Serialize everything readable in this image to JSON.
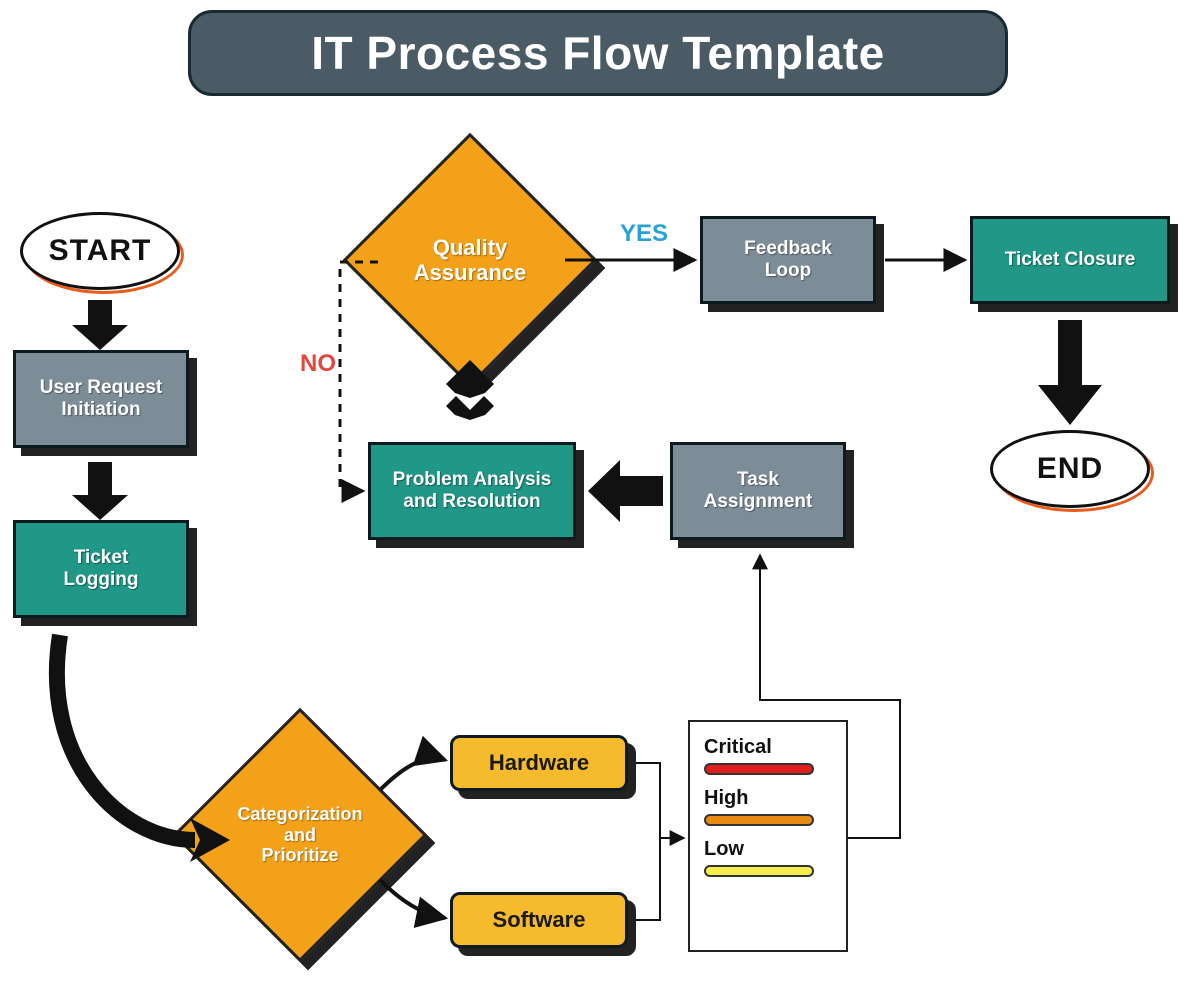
{
  "title": "IT Process Flow Template",
  "terminators": {
    "start": "START",
    "end": "END"
  },
  "nodes": {
    "user_request": "User Request\nInitiation",
    "ticket_logging": "Ticket\nLogging",
    "categorize": "Categorization\nand\nPrioritize",
    "hardware": "Hardware",
    "software": "Software",
    "task_assignment": "Task\nAssignment",
    "problem_analysis": "Problem Analysis\nand Resolution",
    "qa": "Quality\nAssurance",
    "feedback_loop": "Feedback\nLoop",
    "ticket_closure": "Ticket Closure"
  },
  "decision_labels": {
    "yes": "YES",
    "no": "NO"
  },
  "priorities": [
    {
      "label": "Critical",
      "level": "crit",
      "color": "#e21d1d"
    },
    {
      "label": "High",
      "level": "high",
      "color": "#e98a13"
    },
    {
      "label": "Low",
      "level": "low",
      "color": "#f5ef4d"
    }
  ]
}
